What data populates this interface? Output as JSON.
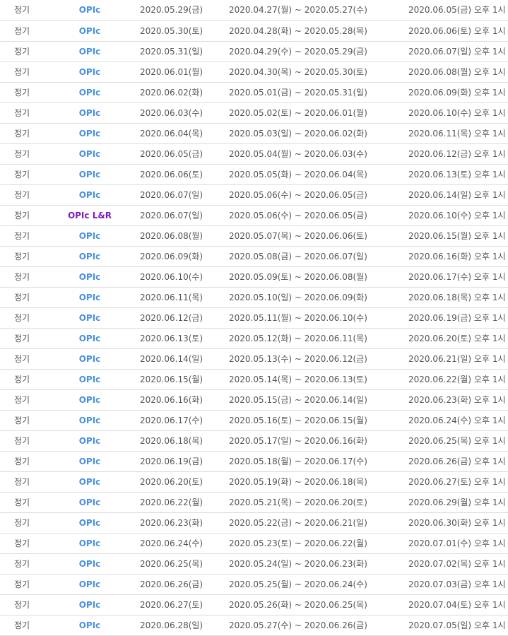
{
  "colors": {
    "opic": "#4a90e2",
    "opic_lr": "#7a1fb8",
    "text": "#555555",
    "divider": "#dcdcdc"
  },
  "rows": [
    {
      "type": "정기",
      "exam": "OPIc",
      "exam_date": "2020.05.29(금)",
      "period": "2020.04.27(월) ~ 2020.05.27(수)",
      "result": "2020.06.05(금) 오후 1시"
    },
    {
      "type": "정기",
      "exam": "OPIc",
      "exam_date": "2020.05.30(토)",
      "period": "2020.04.28(화) ~ 2020.05.28(목)",
      "result": "2020.06.06(토) 오후 1시"
    },
    {
      "type": "정기",
      "exam": "OPIc",
      "exam_date": "2020.05.31(일)",
      "period": "2020.04.29(수) ~ 2020.05.29(금)",
      "result": "2020.06.07(일) 오후 1시"
    },
    {
      "type": "정기",
      "exam": "OPIc",
      "exam_date": "2020.06.01(월)",
      "period": "2020.04.30(목) ~ 2020.05.30(토)",
      "result": "2020.06.08(월) 오후 1시"
    },
    {
      "type": "정기",
      "exam": "OPIc",
      "exam_date": "2020.06.02(화)",
      "period": "2020.05.01(금) ~ 2020.05.31(일)",
      "result": "2020.06.09(화) 오후 1시"
    },
    {
      "type": "정기",
      "exam": "OPIc",
      "exam_date": "2020.06.03(수)",
      "period": "2020.05.02(토) ~ 2020.06.01(월)",
      "result": "2020.06.10(수) 오후 1시"
    },
    {
      "type": "정기",
      "exam": "OPIc",
      "exam_date": "2020.06.04(목)",
      "period": "2020.05.03(일) ~ 2020.06.02(화)",
      "result": "2020.06.11(목) 오후 1시"
    },
    {
      "type": "정기",
      "exam": "OPIc",
      "exam_date": "2020.06.05(금)",
      "period": "2020.05.04(월) ~ 2020.06.03(수)",
      "result": "2020.06.12(금) 오후 1시"
    },
    {
      "type": "정기",
      "exam": "OPIc",
      "exam_date": "2020.06.06(토)",
      "period": "2020.05.05(화) ~ 2020.06.04(목)",
      "result": "2020.06.13(토) 오후 1시"
    },
    {
      "type": "정기",
      "exam": "OPIc",
      "exam_date": "2020.06.07(일)",
      "period": "2020.05.06(수) ~ 2020.06.05(금)",
      "result": "2020.06.14(일) 오후 1시"
    },
    {
      "type": "정기",
      "exam": "OPIc L&R",
      "exam_date": "2020.06.07(일)",
      "period": "2020.05.06(수) ~ 2020.06.05(금)",
      "result": "2020.06.10(수) 오후 1시"
    },
    {
      "type": "정기",
      "exam": "OPIc",
      "exam_date": "2020.06.08(월)",
      "period": "2020.05.07(목) ~ 2020.06.06(토)",
      "result": "2020.06.15(월) 오후 1시"
    },
    {
      "type": "정기",
      "exam": "OPIc",
      "exam_date": "2020.06.09(화)",
      "period": "2020.05.08(금) ~ 2020.06.07(일)",
      "result": "2020.06.16(화) 오후 1시"
    },
    {
      "type": "정기",
      "exam": "OPIc",
      "exam_date": "2020.06.10(수)",
      "period": "2020.05.09(토) ~ 2020.06.08(월)",
      "result": "2020.06.17(수) 오후 1시"
    },
    {
      "type": "정기",
      "exam": "OPIc",
      "exam_date": "2020.06.11(목)",
      "period": "2020.05.10(일) ~ 2020.06.09(화)",
      "result": "2020.06.18(목) 오후 1시"
    },
    {
      "type": "정기",
      "exam": "OPIc",
      "exam_date": "2020.06.12(금)",
      "period": "2020.05.11(월) ~ 2020.06.10(수)",
      "result": "2020.06.19(금) 오후 1시"
    },
    {
      "type": "정기",
      "exam": "OPIc",
      "exam_date": "2020.06.13(토)",
      "period": "2020.05.12(화) ~ 2020.06.11(목)",
      "result": "2020.06.20(토) 오후 1시"
    },
    {
      "type": "정기",
      "exam": "OPIc",
      "exam_date": "2020.06.14(일)",
      "period": "2020.05.13(수) ~ 2020.06.12(금)",
      "result": "2020.06.21(일) 오후 1시"
    },
    {
      "type": "정기",
      "exam": "OPIc",
      "exam_date": "2020.06.15(월)",
      "period": "2020.05.14(목) ~ 2020.06.13(토)",
      "result": "2020.06.22(월) 오후 1시"
    },
    {
      "type": "정기",
      "exam": "OPIc",
      "exam_date": "2020.06.16(화)",
      "period": "2020.05.15(금) ~ 2020.06.14(일)",
      "result": "2020.06.23(화) 오후 1시"
    },
    {
      "type": "정기",
      "exam": "OPIc",
      "exam_date": "2020.06.17(수)",
      "period": "2020.05.16(토) ~ 2020.06.15(월)",
      "result": "2020.06.24(수) 오후 1시"
    },
    {
      "type": "정기",
      "exam": "OPIc",
      "exam_date": "2020.06.18(목)",
      "period": "2020.05.17(일) ~ 2020.06.16(화)",
      "result": "2020.06.25(목) 오후 1시"
    },
    {
      "type": "정기",
      "exam": "OPIc",
      "exam_date": "2020.06.19(금)",
      "period": "2020.05.18(월) ~ 2020.06.17(수)",
      "result": "2020.06.26(금) 오후 1시"
    },
    {
      "type": "정기",
      "exam": "OPIc",
      "exam_date": "2020.06.20(토)",
      "period": "2020.05.19(화) ~ 2020.06.18(목)",
      "result": "2020.06.27(토) 오후 1시"
    },
    {
      "type": "정기",
      "exam": "OPIc",
      "exam_date": "2020.06.22(월)",
      "period": "2020.05.21(목) ~ 2020.06.20(토)",
      "result": "2020.06.29(월) 오후 1시"
    },
    {
      "type": "정기",
      "exam": "OPIc",
      "exam_date": "2020.06.23(화)",
      "period": "2020.05.22(금) ~ 2020.06.21(일)",
      "result": "2020.06.30(화) 오후 1시"
    },
    {
      "type": "정기",
      "exam": "OPIc",
      "exam_date": "2020.06.24(수)",
      "period": "2020.05.23(토) ~ 2020.06.22(월)",
      "result": "2020.07.01(수) 오후 1시"
    },
    {
      "type": "정기",
      "exam": "OPIc",
      "exam_date": "2020.06.25(목)",
      "period": "2020.05.24(일) ~ 2020.06.23(화)",
      "result": "2020.07.02(목) 오후 1시"
    },
    {
      "type": "정기",
      "exam": "OPIc",
      "exam_date": "2020.06.26(금)",
      "period": "2020.05.25(월) ~ 2020.06.24(수)",
      "result": "2020.07.03(금) 오후 1시"
    },
    {
      "type": "정기",
      "exam": "OPIc",
      "exam_date": "2020.06.27(토)",
      "period": "2020.05.26(화) ~ 2020.06.25(목)",
      "result": "2020.07.04(토) 오후 1시"
    },
    {
      "type": "정기",
      "exam": "OPIc",
      "exam_date": "2020.06.28(일)",
      "period": "2020.05.27(수) ~ 2020.06.26(금)",
      "result": "2020.07.05(일) 오후 1시"
    }
  ]
}
